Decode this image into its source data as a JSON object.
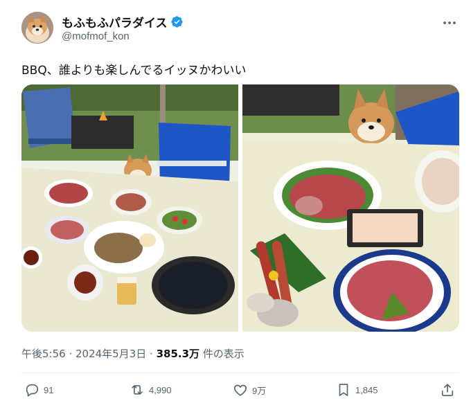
{
  "user": {
    "display_name": "もふもふパラダイス",
    "handle": "@mofmof_kon",
    "verified_icon": "verified-badge-icon"
  },
  "tweet": {
    "text": "BBQ、誰よりも楽しんでるイッヌかわいい"
  },
  "meta": {
    "time": "午後5:56",
    "separator": " · ",
    "date": "2024年5月3日",
    "views_count": "385.3万",
    "views_label": " 件の表示"
  },
  "actions": {
    "reply": {
      "icon": "reply-icon",
      "count": "91"
    },
    "retweet": {
      "icon": "retweet-icon",
      "count": "4,990"
    },
    "like": {
      "icon": "heart-icon",
      "count": "9万"
    },
    "bookmark": {
      "icon": "bookmark-icon",
      "count": "1,845"
    },
    "share": {
      "icon": "share-icon"
    }
  },
  "colors": {
    "verified": "#1d9bf0",
    "secondary_text": "#536471",
    "primary_text": "#0f1419"
  }
}
